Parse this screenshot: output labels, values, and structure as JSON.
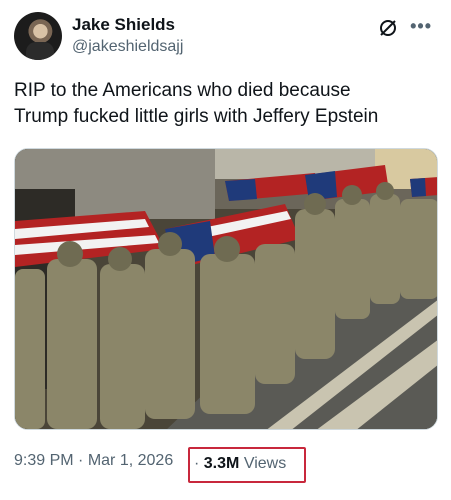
{
  "author": {
    "name": "Jake Shields",
    "handle": "@jakeshieldsajj"
  },
  "icons": {
    "grok": "grok-icon",
    "more": "more-options-icon"
  },
  "tweet": {
    "line1": "RIP to the Americans who died because",
    "line2": "Trump fucked little girls with Jeffery Epstein"
  },
  "meta": {
    "time": "9:39 PM",
    "separator": "·",
    "date": "Mar 1, 2026",
    "views_count": "3.3M",
    "views_label": "Views"
  },
  "colors": {
    "text": "#0f1419",
    "secondary": "#536471",
    "highlight_box": "#c8283c"
  }
}
